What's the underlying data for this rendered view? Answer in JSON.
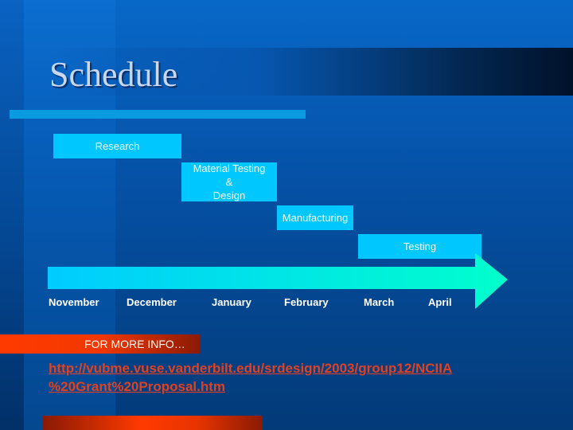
{
  "slide": {
    "title": "Schedule",
    "tasks": [
      {
        "label": "Research"
      },
      {
        "label": "Material Testing\n&\nDesign"
      },
      {
        "label": "Manufacturing"
      },
      {
        "label": "Testing"
      }
    ],
    "timeline": {
      "months": [
        "November",
        "December",
        "January",
        "February",
        "March",
        "April"
      ]
    },
    "info_label": "FOR MORE INFO…",
    "link": "http://vubme.vuse.vanderbilt.edu/srdesign/2003/group12/NCIIA %20Grant%20Proposal.htm"
  },
  "colors": {
    "task_fill": "#00c8ff",
    "arrow_start": "#00ccff",
    "arrow_end": "#00ffcc",
    "accent_red": "#ff3a00",
    "link": "#e2401e"
  }
}
